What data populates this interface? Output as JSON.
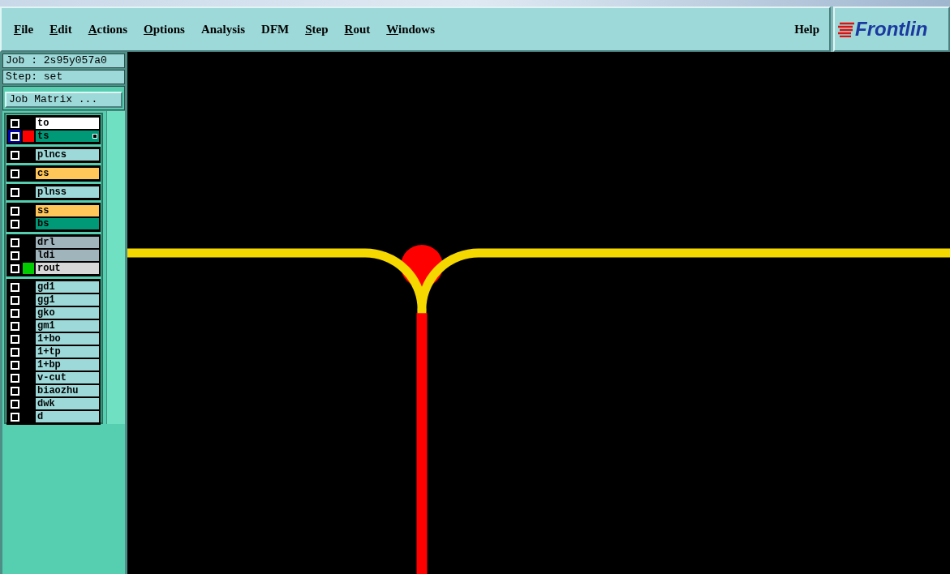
{
  "menu": [
    {
      "label": "File",
      "underlined": true
    },
    {
      "label": "Edit",
      "underlined": true
    },
    {
      "label": "Actions",
      "underlined": true
    },
    {
      "label": "Options",
      "underlined": true
    },
    {
      "label": "Analysis",
      "underlined": false
    },
    {
      "label": "DFM",
      "underlined": false
    },
    {
      "label": "Step",
      "underlined": true
    },
    {
      "label": "Rout",
      "underlined": true
    },
    {
      "label": "Windows",
      "underlined": true
    }
  ],
  "help": "Help",
  "logo": "Frontlin",
  "job": "Job : 2s95y057a0",
  "step": "Step: set",
  "job_matrix_button": "Job Matrix ...",
  "layer_groups": [
    [
      {
        "name": "to",
        "color": "#ffffff",
        "focused": false
      },
      {
        "name": "ts",
        "color": "#009977",
        "swatch": {
          "color": "#ff0000"
        },
        "focused": true
      }
    ],
    [
      {
        "name": "plncs",
        "color": "#9ed9d9",
        "focused": false
      }
    ],
    [
      {
        "name": "cs",
        "color": "#ffc659",
        "focused": false
      }
    ],
    [
      {
        "name": "plnss",
        "color": "#9ed9d9",
        "focused": false
      }
    ],
    [
      {
        "name": "ss",
        "color": "#ffc659",
        "focused": false
      },
      {
        "name": "bs",
        "color": "#009977",
        "focused": false
      }
    ],
    [
      {
        "name": "drl",
        "color": "#a0b4bc",
        "focused": false
      },
      {
        "name": "ldi",
        "color": "#a0b4bc",
        "focused": false
      },
      {
        "name": "rout",
        "color": "#d8d8d8",
        "swatch": {
          "color": "#00cc00"
        },
        "focused": false
      }
    ],
    [
      {
        "name": "gd1",
        "color": "#9ed9d9",
        "focused": false
      },
      {
        "name": "gg1",
        "color": "#9ed9d9",
        "focused": false
      },
      {
        "name": "gko",
        "color": "#9ed9d9",
        "focused": false
      },
      {
        "name": "gm1",
        "color": "#9ed9d9",
        "focused": false
      },
      {
        "name": "1+bo",
        "color": "#9ed9d9",
        "focused": false
      },
      {
        "name": "1+tp",
        "color": "#9ed9d9",
        "focused": false
      },
      {
        "name": "1+bp",
        "color": "#9ed9d9",
        "focused": false
      },
      {
        "name": "v-cut",
        "color": "#9ed9d9",
        "focused": false
      },
      {
        "name": "biaozhu",
        "color": "#9ed9d9",
        "focused": false
      },
      {
        "name": "dwk",
        "color": "#9ed9d9",
        "focused": false
      },
      {
        "name": "d",
        "color": "#9ed9d9",
        "focused": false
      }
    ]
  ]
}
